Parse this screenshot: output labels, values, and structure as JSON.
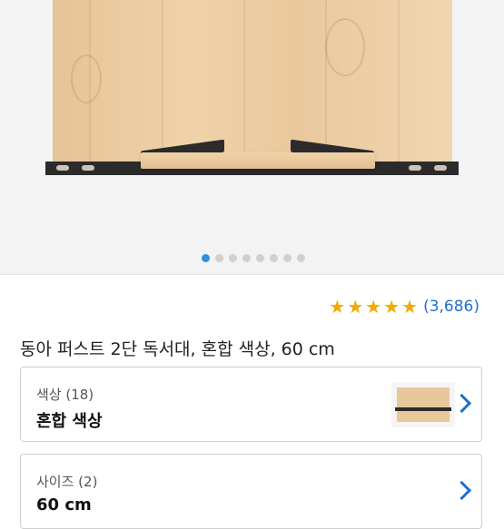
{
  "gallery": {
    "dots_total": 8,
    "active_index": 0,
    "accent_color": "#2f8fe0"
  },
  "product": {
    "rating_stars": 5,
    "rating_count": "(3,686)",
    "title": "동아 퍼스트 2단 독서대, 혼합 색상, 60 cm"
  },
  "options": {
    "color": {
      "label": "색상 (18)",
      "value": "혼합 색상"
    },
    "size": {
      "label": "사이즈 (2)",
      "value": "60 cm"
    }
  },
  "icons": {
    "star": "star-icon",
    "chevron": "chevron-right-icon"
  }
}
